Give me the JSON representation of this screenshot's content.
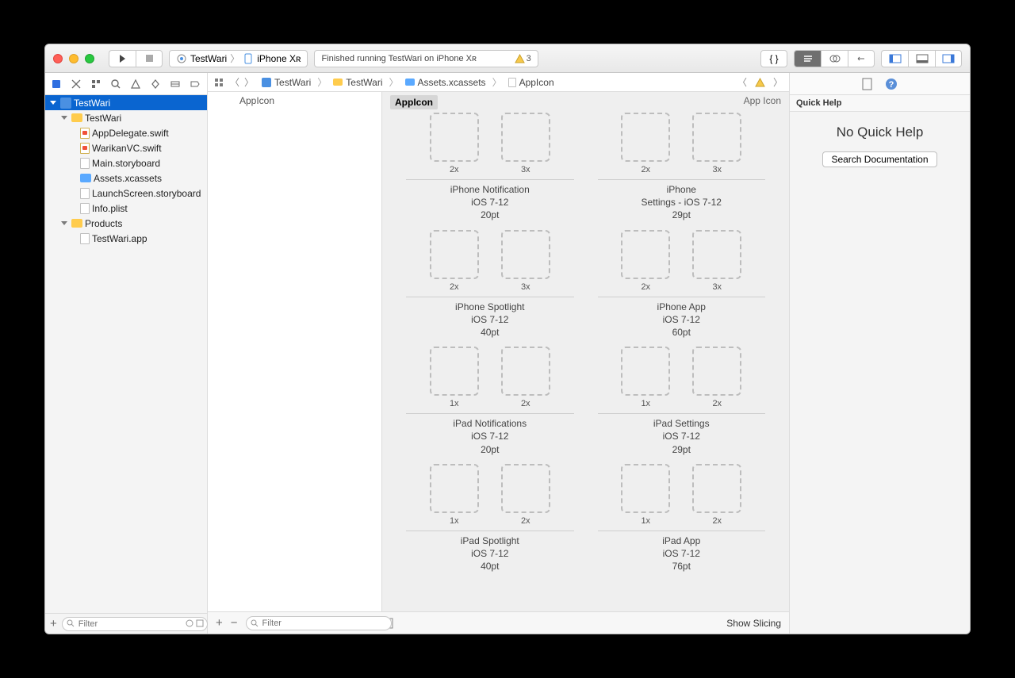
{
  "toolbar": {
    "scheme_project": "TestWari",
    "scheme_device": "iPhone Xʀ",
    "status_text": "Finished running TestWari on iPhone Xʀ",
    "warning_count": "3"
  },
  "breadcrumb": {
    "root": "TestWari",
    "group": "TestWari",
    "asset_catalog": "Assets.xcassets",
    "asset": "AppIcon"
  },
  "navigator_tree": {
    "project": "TestWari",
    "group": "TestWari",
    "files": [
      "AppDelegate.swift",
      "WarikanVC.swift",
      "Main.storyboard",
      "Assets.xcassets",
      "LaunchScreen.storyboard",
      "Info.plist"
    ],
    "products_group": "Products",
    "product_app": "TestWari.app"
  },
  "filter_placeholder": "Filter",
  "outline": {
    "item": "AppIcon"
  },
  "asset": {
    "title": "AppIcon",
    "kind": "App Icon",
    "groups": [
      {
        "scales": [
          "2x",
          "3x"
        ],
        "title": "iPhone Notification",
        "os": "iOS 7-12",
        "size": "20pt"
      },
      {
        "scales": [
          "2x",
          "3x"
        ],
        "title": "iPhone",
        "os": "Settings - iOS 7-12",
        "size": "29pt"
      },
      {
        "scales": [
          "2x",
          "3x"
        ],
        "title": "iPhone Spotlight",
        "os": "iOS 7-12",
        "size": "40pt"
      },
      {
        "scales": [
          "2x",
          "3x"
        ],
        "title": "iPhone App",
        "os": "iOS 7-12",
        "size": "60pt"
      },
      {
        "scales": [
          "1x",
          "2x"
        ],
        "title": "iPad Notifications",
        "os": "iOS 7-12",
        "size": "20pt"
      },
      {
        "scales": [
          "1x",
          "2x"
        ],
        "title": "iPad Settings",
        "os": "iOS 7-12",
        "size": "29pt"
      },
      {
        "scales": [
          "1x",
          "2x"
        ],
        "title": "iPad Spotlight",
        "os": "iOS 7-12",
        "size": "40pt"
      },
      {
        "scales": [
          "1x",
          "2x"
        ],
        "title": "iPad App",
        "os": "iOS 7-12",
        "size": "76pt"
      }
    ],
    "show_slicing": "Show Slicing"
  },
  "inspector": {
    "section": "Quick Help",
    "heading": "No Quick Help",
    "button": "Search Documentation"
  }
}
